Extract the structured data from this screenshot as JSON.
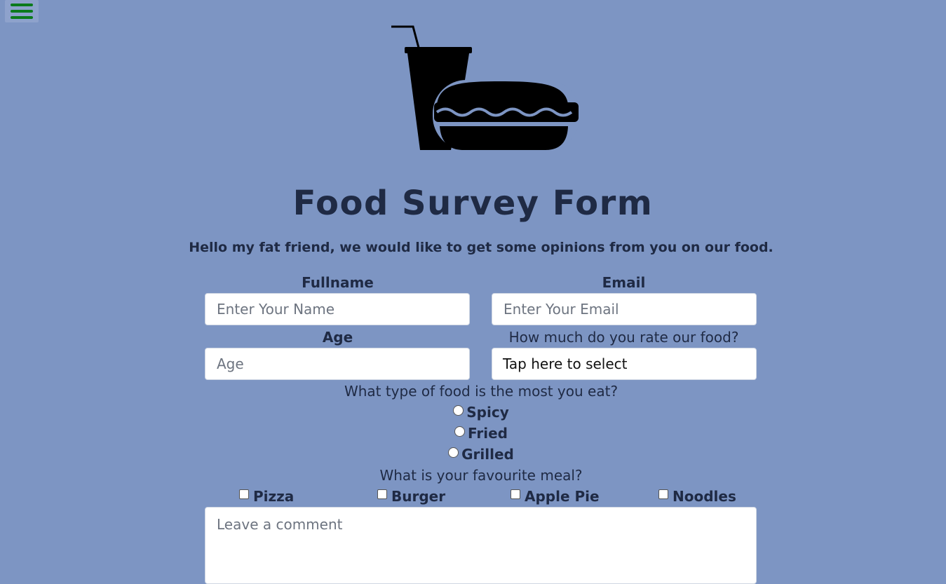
{
  "nav": {
    "menu_icon": "hamburger-menu-icon",
    "menu_color": "#0c7a1c"
  },
  "logo": {
    "icon": "soda-and-burger-icon"
  },
  "page": {
    "title": "Food Survey Form",
    "intro": "Hello my fat friend, we would like to get some opinions from you on our food.",
    "background": "#7d95c3"
  },
  "form": {
    "fullname": {
      "label": "Fullname",
      "placeholder": "Enter Your Name"
    },
    "email": {
      "label": "Email",
      "placeholder": "Enter Your Email"
    },
    "age": {
      "label": "Age",
      "placeholder": "Age"
    },
    "rating": {
      "label": "How much do you rate our food?",
      "selected": "Tap here to select"
    },
    "food_type": {
      "question": "What type of food is the most you eat?",
      "options": [
        "Spicy",
        "Fried",
        "Grilled"
      ]
    },
    "meal": {
      "question": "What is your favourite meal?",
      "options": [
        "Pizza",
        "Burger",
        "Apple Pie",
        "Noodles"
      ]
    },
    "comment": {
      "placeholder": "Leave a comment"
    }
  }
}
